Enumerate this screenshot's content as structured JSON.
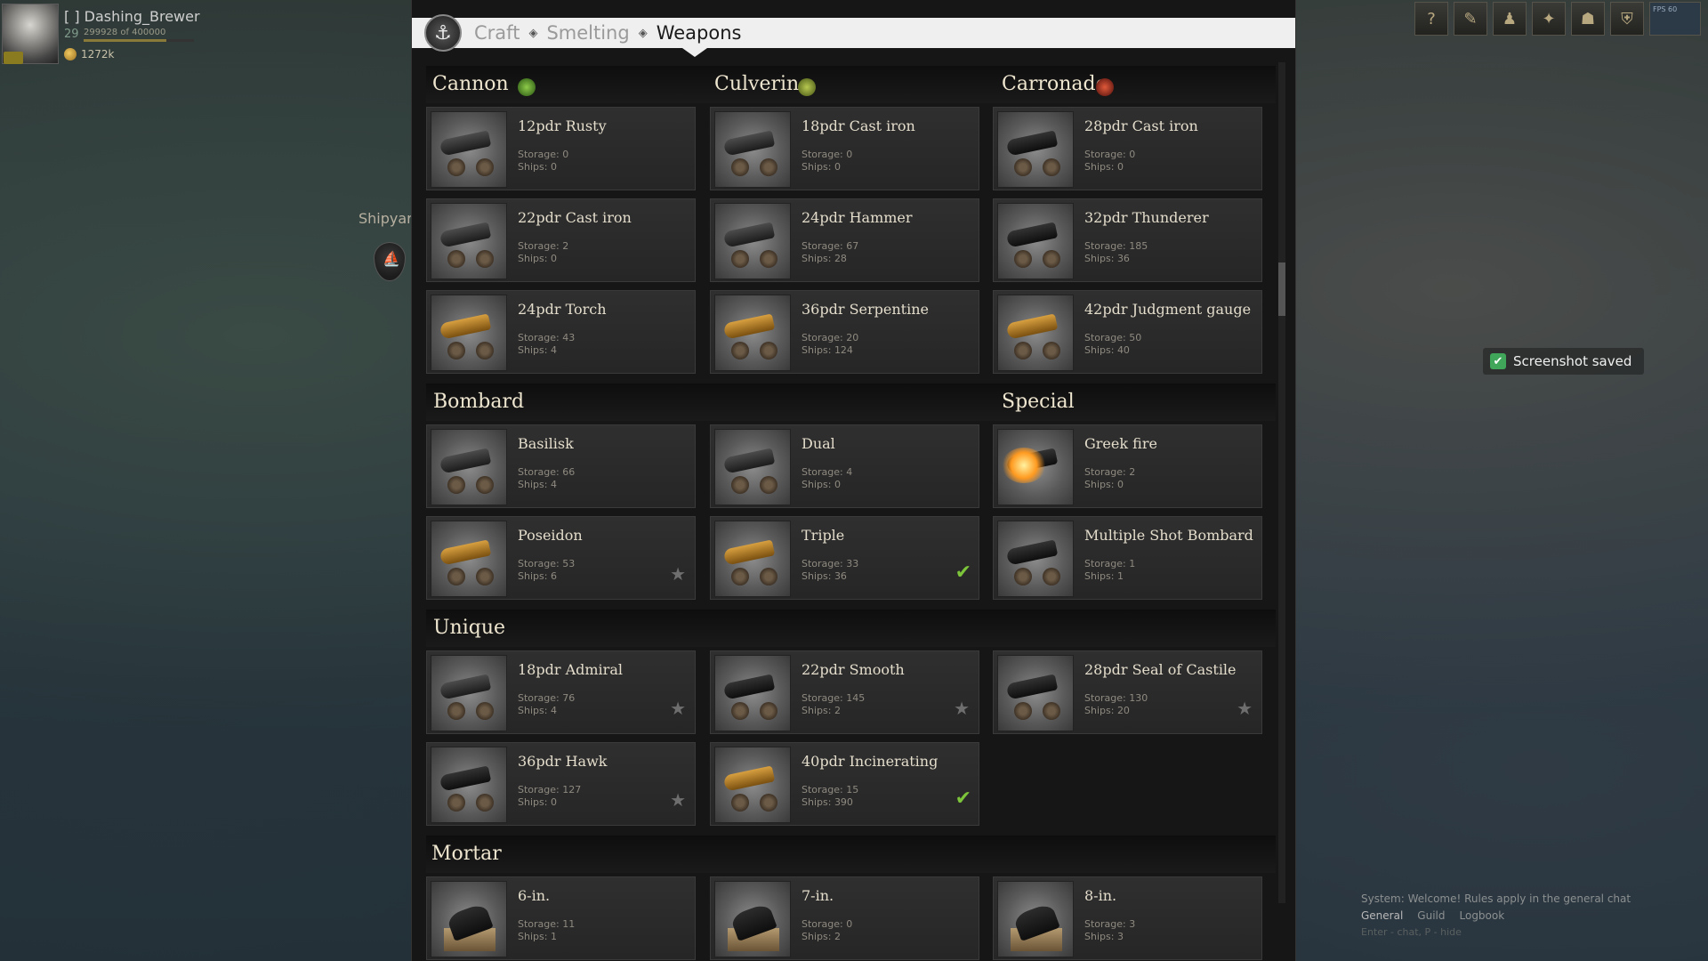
{
  "player": {
    "name": "[    ] Dashing_Brewer",
    "level": "29",
    "xp": "299928 of 400000",
    "xp_progress": 0.75,
    "gold": "1272k"
  },
  "map": {
    "shipyard_label": "Shipyar"
  },
  "hud": {
    "buttons": [
      {
        "icon": "help-icon",
        "glyph": "?"
      },
      {
        "icon": "quest-icon",
        "glyph": "✎"
      },
      {
        "icon": "crew-icon",
        "glyph": "♟"
      },
      {
        "icon": "compass-icon",
        "glyph": "✦"
      },
      {
        "icon": "mask-icon",
        "glyph": "☗"
      },
      {
        "icon": "shield-icon",
        "glyph": "⛨"
      }
    ],
    "mini_text": "FPS 60"
  },
  "toast": {
    "text": "Screenshot saved"
  },
  "chat": {
    "message": "System: Welcome! Rules apply in the general chat",
    "tabs": [
      "General",
      "Guild",
      "Logbook"
    ],
    "input_hint": "Enter - chat, P - hide"
  },
  "breadcrumb": {
    "items": [
      "Craft",
      "Smelting",
      "Weapons"
    ],
    "separator": "◈"
  },
  "labels": {
    "storage": "Storage:",
    "ships": "Ships:"
  },
  "sections": {
    "cannon": {
      "title": "Cannon",
      "items": [
        {
          "name": "12pdr Rusty",
          "storage": "0",
          "ships": "0"
        },
        {
          "name": "22pdr Cast iron",
          "storage": "2",
          "ships": "0"
        },
        {
          "name": "24pdr Torch",
          "storage": "43",
          "ships": "4"
        }
      ]
    },
    "culverin": {
      "title": "Culverin",
      "items": [
        {
          "name": "18pdr Cast iron",
          "storage": "0",
          "ships": "0"
        },
        {
          "name": "24pdr Hammer",
          "storage": "67",
          "ships": "28"
        },
        {
          "name": "36pdr Serpentine",
          "storage": "20",
          "ships": "124"
        }
      ]
    },
    "carronade": {
      "title": "Carronade",
      "items": [
        {
          "name": "28pdr Cast iron",
          "storage": "0",
          "ships": "0"
        },
        {
          "name": "32pdr Thunderer",
          "storage": "185",
          "ships": "36"
        },
        {
          "name": "42pdr Judgment gauge",
          "storage": "50",
          "ships": "40"
        }
      ]
    },
    "bombard": {
      "title": "Bombard",
      "items": [
        {
          "name": "Basilisk",
          "storage": "66",
          "ships": "4"
        },
        {
          "name": "Dual",
          "storage": "4",
          "ships": "0"
        },
        {
          "name": "Poseidon",
          "storage": "53",
          "ships": "6",
          "mark": "star"
        },
        {
          "name": "Triple",
          "storage": "33",
          "ships": "36",
          "mark": "check"
        }
      ]
    },
    "special": {
      "title": "Special",
      "items": [
        {
          "name": "Greek fire",
          "storage": "2",
          "ships": "0"
        },
        {
          "name": "Multiple Shot Bombard",
          "storage": "1",
          "ships": "1"
        }
      ]
    },
    "unique": {
      "title": "Unique",
      "items": [
        {
          "name": "18pdr Admiral",
          "storage": "76",
          "ships": "4",
          "mark": "star"
        },
        {
          "name": "22pdr Smooth",
          "storage": "145",
          "ships": "2",
          "mark": "star"
        },
        {
          "name": "28pdr Seal of Castile",
          "storage": "130",
          "ships": "20",
          "mark": "star"
        },
        {
          "name": "36pdr Hawk",
          "storage": "127",
          "ships": "0",
          "mark": "star"
        },
        {
          "name": "40pdr Incinerating",
          "storage": "15",
          "ships": "390",
          "mark": "check"
        }
      ]
    },
    "mortar": {
      "title": "Mortar",
      "items": [
        {
          "name": "6-in.",
          "storage": "11",
          "ships": "1"
        },
        {
          "name": "7-in.",
          "storage": "0",
          "ships": "2"
        },
        {
          "name": "8-in.",
          "storage": "3",
          "ships": "3"
        }
      ]
    }
  }
}
